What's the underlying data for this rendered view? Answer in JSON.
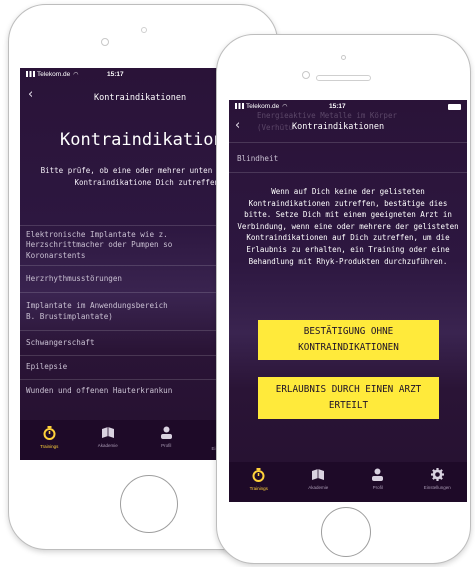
{
  "status_bar": {
    "carrier": "Telekom.de",
    "time": "15:17"
  },
  "back_phone": {
    "nav_title": "Kontraindikationen",
    "page_title": "Kontraindikationen",
    "intro": "Bitte prüfe, ob eine oder mehrer unten genannten Kontraindikatione Dich zutreffen!",
    "list": [
      "Elektronische Implantate wie z.",
      "Herzschrittmacher oder Pumpen so",
      "Koronarstents",
      "Herzrhythmusstörungen",
      "Implantate im Anwendungsbereich",
      "B. Brustimplantate)",
      "Schwangerschaft",
      "Epilepsie",
      "Wunden und offenen Hauterkrankun"
    ]
  },
  "front_phone": {
    "nav_title": "Kontraindikationen",
    "scrolled_item_1": "Energieaktive Metalle im Körper",
    "scrolled_item_2": "(Verhütu",
    "blind_item": "Blindheit",
    "info": "Wenn auf Dich keine der gelisteten Kontraindikationen zutreffen, bestätige dies bitte. Setze Dich mit einem geeigneten Arzt in Verbindung, wenn eine oder mehrere der gelisteten Kontraindikationen auf Dich zutreffen, um die Erlaubnis zu erhalten, ein Training oder eine Behandlung mit Rhyk-Produkten durchzuführen.",
    "confirm_button": "BESTÄTIGUNG OHNE KONTRAINDIKATIONEN",
    "permission_button": "ERLAUBNIS DURCH EINEN ARZT ERTEILT"
  },
  "tabs": [
    {
      "label": "Trainings",
      "icon": "stopwatch-icon"
    },
    {
      "label": "Akademie",
      "icon": "book-icon"
    },
    {
      "label": "Profil",
      "icon": "person-icon"
    },
    {
      "label": "Einstellungen",
      "icon": "gear-icon"
    }
  ],
  "back_tab_partial": "Ei",
  "colors": {
    "accent": "#ffd23b",
    "button": "#ffea3b",
    "background": "#2a1338",
    "tabbar": "#1e0a28"
  }
}
